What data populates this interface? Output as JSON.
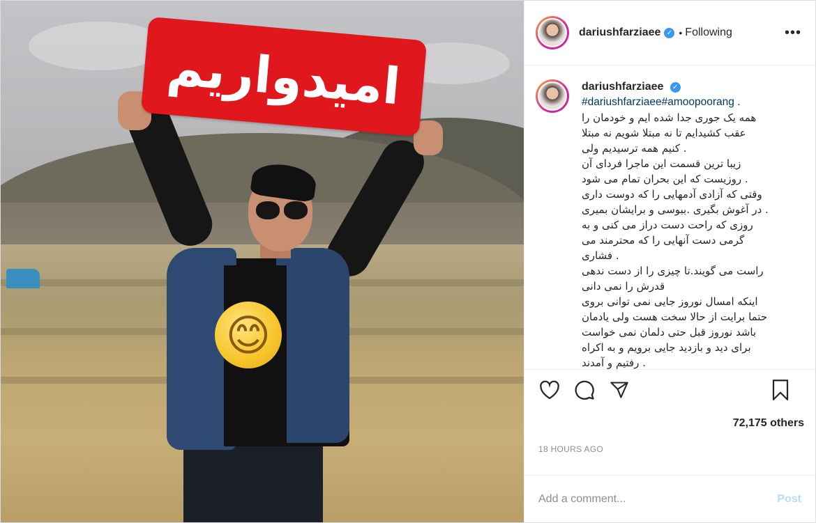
{
  "header": {
    "username": "dariushfarziaee",
    "separator": "•",
    "follow_status": "Following",
    "more_icon": "more-horizontal-icon"
  },
  "photo": {
    "sign_text": "امیدواریم",
    "emoji": "😊",
    "colors": {
      "sign": "#e1171e",
      "verified": "#3897f0"
    }
  },
  "caption": {
    "username": "dariushfarziaee",
    "hashtags": "#dariushfarziaee#amoopoorang",
    "hashtags_suffix": " .",
    "lines": [
      "همه یک جوری جدا شده ایم و خودمان را",
      "عقب کشیدایم تا نه مبتلا شویم نه مبتلا",
      ". کنیم همه ترسیدیم ولی",
      "زیبا ترین قسمت این ماجرا فردای آن",
      ". روزیست که این بحران تمام می شود",
      "وقتی که آزادی آدمهایی را که دوست داری",
      ". در آغوش بگیری .ببوسی و برایشان بمیری",
      "روزی که راحت دست دراز می کنی و به",
      "گرمی دست آنهایی را که محترمند می",
      ". فشاری",
      "راست می گویند.تا چیزی را از دست ندهی",
      "قدرش را نمی دانی",
      "اینکه امسال نوروز جایی نمی توانی بروی",
      "حتما برایت از حالا سخت هست ولی یادمان",
      "باشد نوروز قبل حتی دلمان نمی خواست",
      "برای دید و بازدید جایی برویم و به اکراه",
      ". رفتیم و آمدند"
    ]
  },
  "actions": {
    "like_icon": "heart-icon",
    "comment_icon": "comment-bubble-icon",
    "share_icon": "paper-plane-icon",
    "save_icon": "bookmark-icon"
  },
  "likes_text": "72,175 others",
  "timestamp": "18 HOURS AGO",
  "comment_box": {
    "placeholder": "Add a comment...",
    "post_label": "Post"
  }
}
